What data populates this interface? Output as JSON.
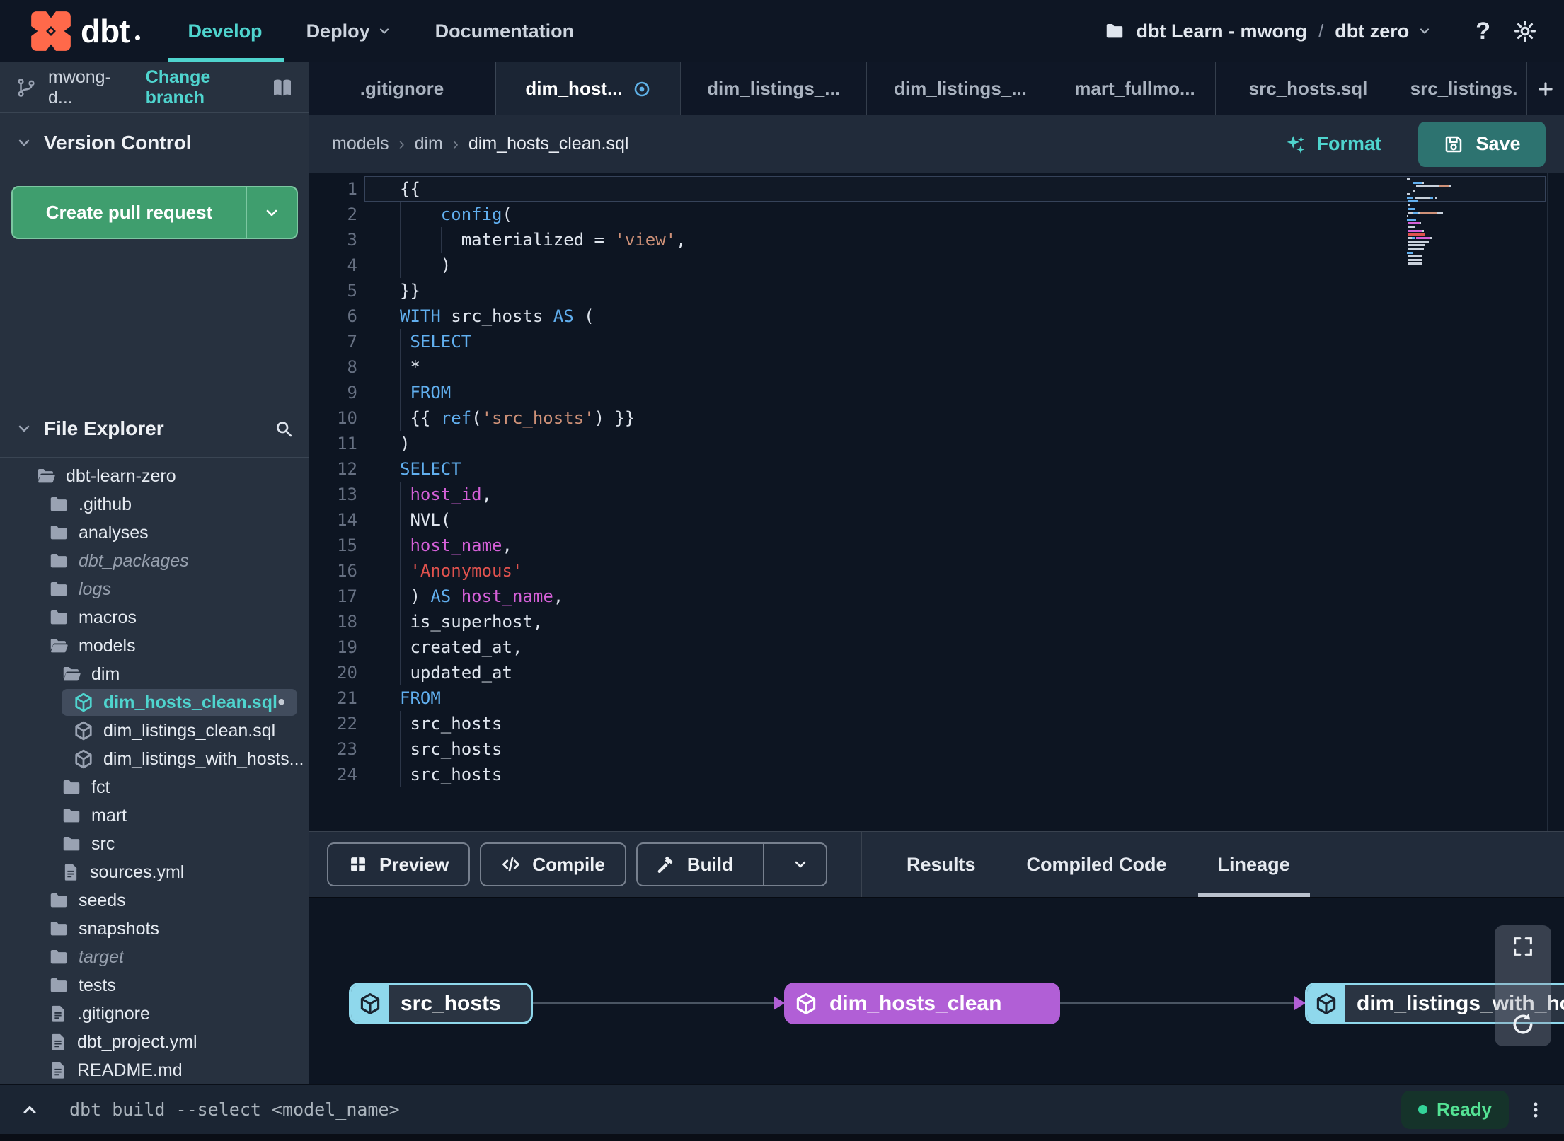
{
  "theme": {
    "navbar_bg": "#0e1624",
    "sidebar_bg": "#27313f",
    "divider": "#3a4553",
    "strip_bg": "#0f1726",
    "active_tab_bg": "#1b2534",
    "header_bg": "#212b3a",
    "editor_bg": "#0d1522",
    "panel_bg": "#212b3a",
    "lineage_bg": "#0d1522",
    "statusbar_bg": "#1b2533",
    "accent_teal": "#4fd4ce",
    "green": "#3f9e6e",
    "green_border": "#7cc7a1",
    "save_teal": "#2d7370",
    "kw": "#61afef",
    "str": "#ce9178",
    "str_red": "#e0524e",
    "magenta": "#d560d8",
    "fg": "#dfe5ee",
    "line_num": "#667082",
    "node_blue": "#8fd8ec",
    "node_purple": "#b15fd6",
    "edge": "#4a5563",
    "ready_green": "#54e294",
    "logo_orange": "#ff694a"
  },
  "navbar": {
    "logo_text": "dbt",
    "items": [
      {
        "label": "Develop",
        "active": true,
        "chevron": false
      },
      {
        "label": "Deploy",
        "active": false,
        "chevron": true
      },
      {
        "label": "Documentation",
        "active": false,
        "chevron": false
      }
    ],
    "account": "dbt Learn - mwong",
    "separator": "/",
    "project": "dbt zero",
    "help_label": "?"
  },
  "sidebar": {
    "branch_name": "mwong-d...",
    "change_branch_label": "Change branch",
    "version_control_label": "Version Control",
    "create_pr_label": "Create pull request",
    "file_explorer_label": "File Explorer",
    "tree": [
      {
        "name": "dbt-learn-zero",
        "icon": "folder-open",
        "level": 1
      },
      {
        "name": ".github",
        "icon": "folder",
        "level": 2
      },
      {
        "name": "analyses",
        "icon": "folder",
        "level": 2
      },
      {
        "name": "dbt_packages",
        "icon": "folder",
        "level": 2,
        "muted": true
      },
      {
        "name": "logs",
        "icon": "folder",
        "level": 2,
        "muted": true
      },
      {
        "name": "macros",
        "icon": "folder",
        "level": 2
      },
      {
        "name": "models",
        "icon": "folder-open",
        "level": 2
      },
      {
        "name": "dim",
        "icon": "folder-open",
        "level": 3
      },
      {
        "name": "dim_hosts_clean.sql",
        "icon": "model",
        "level": 4,
        "selected": true,
        "modified": true
      },
      {
        "name": "dim_listings_clean.sql",
        "icon": "model",
        "level": 4
      },
      {
        "name": "dim_listings_with_hosts...",
        "icon": "model",
        "level": 4
      },
      {
        "name": "fct",
        "icon": "folder",
        "level": 3
      },
      {
        "name": "mart",
        "icon": "folder",
        "level": 3
      },
      {
        "name": "src",
        "icon": "folder",
        "level": 3
      },
      {
        "name": "sources.yml",
        "icon": "file",
        "level": 3
      },
      {
        "name": "seeds",
        "icon": "folder",
        "level": 2
      },
      {
        "name": "snapshots",
        "icon": "folder",
        "level": 2
      },
      {
        "name": "target",
        "icon": "folder",
        "level": 2,
        "muted": true
      },
      {
        "name": "tests",
        "icon": "folder",
        "level": 2
      },
      {
        "name": ".gitignore",
        "icon": "file",
        "level": 2
      },
      {
        "name": "dbt_project.yml",
        "icon": "file",
        "level": 2
      },
      {
        "name": "README.md",
        "icon": "file",
        "level": 2
      }
    ]
  },
  "tabs": [
    {
      "label": ".gitignore"
    },
    {
      "label": "dim_host...",
      "active": true,
      "modified": true
    },
    {
      "label": "dim_listings_..."
    },
    {
      "label": "dim_listings_..."
    },
    {
      "label": "mart_fullmo..."
    },
    {
      "label": "src_hosts.sql"
    },
    {
      "label": "src_listings."
    }
  ],
  "editor_header": {
    "breadcrumb": [
      "models",
      "dim",
      "dim_hosts_clean.sql"
    ],
    "format_label": "Format",
    "save_label": "Save"
  },
  "editor": {
    "lines": [
      {
        "n": 1,
        "current": true,
        "tokens": [
          [
            "fg",
            "{{"
          ]
        ]
      },
      {
        "n": 2,
        "g": [
          0
        ],
        "tokens": [
          [
            "fg",
            "    "
          ],
          [
            "kw",
            "config"
          ],
          [
            "fg",
            "("
          ]
        ]
      },
      {
        "n": 3,
        "g": [
          0,
          58
        ],
        "tokens": [
          [
            "fg",
            "      materialized = "
          ],
          [
            "str",
            "'view'"
          ],
          [
            "fg",
            ","
          ]
        ]
      },
      {
        "n": 4,
        "g": [
          0
        ],
        "tokens": [
          [
            "fg",
            "    )"
          ]
        ]
      },
      {
        "n": 5,
        "tokens": [
          [
            "fg",
            "}}"
          ]
        ]
      },
      {
        "n": 6,
        "tokens": [
          [
            "kw",
            "WITH"
          ],
          [
            "fg",
            " src_hosts "
          ],
          [
            "kw",
            "AS"
          ],
          [
            "fg",
            " ("
          ]
        ]
      },
      {
        "n": 7,
        "g": [
          0
        ],
        "tokens": [
          [
            "fg",
            " "
          ],
          [
            "kw",
            "SELECT"
          ]
        ]
      },
      {
        "n": 8,
        "g": [
          0
        ],
        "tokens": [
          [
            "fg",
            " *"
          ]
        ]
      },
      {
        "n": 9,
        "g": [
          0
        ],
        "tokens": [
          [
            "fg",
            " "
          ],
          [
            "kw",
            "FROM"
          ]
        ]
      },
      {
        "n": 10,
        "g": [
          0
        ],
        "tokens": [
          [
            "fg",
            " {{ "
          ],
          [
            "kw",
            "ref"
          ],
          [
            "fg",
            "("
          ],
          [
            "str",
            "'src_hosts'"
          ],
          [
            "fg",
            ") }}"
          ]
        ]
      },
      {
        "n": 11,
        "tokens": [
          [
            "fg",
            ")"
          ]
        ]
      },
      {
        "n": 12,
        "tokens": [
          [
            "kw",
            "SELECT"
          ]
        ]
      },
      {
        "n": 13,
        "g": [
          0
        ],
        "tokens": [
          [
            "fg",
            " "
          ],
          [
            "mag",
            "host_id"
          ],
          [
            "fg",
            ","
          ]
        ]
      },
      {
        "n": 14,
        "g": [
          0
        ],
        "tokens": [
          [
            "fg",
            " NVL("
          ]
        ]
      },
      {
        "n": 15,
        "g": [
          0
        ],
        "tokens": [
          [
            "fg",
            " "
          ],
          [
            "mag",
            "host_name"
          ],
          [
            "fg",
            ","
          ]
        ]
      },
      {
        "n": 16,
        "g": [
          0
        ],
        "tokens": [
          [
            "fg",
            " "
          ],
          [
            "strr",
            "'Anonymous'"
          ]
        ]
      },
      {
        "n": 17,
        "g": [
          0
        ],
        "tokens": [
          [
            "fg",
            " ) "
          ],
          [
            "kw",
            "AS"
          ],
          [
            "fg",
            " "
          ],
          [
            "mag",
            "host_name"
          ],
          [
            "fg",
            ","
          ]
        ]
      },
      {
        "n": 18,
        "g": [
          0
        ],
        "tokens": [
          [
            "fg",
            " is_superhost,"
          ]
        ]
      },
      {
        "n": 19,
        "g": [
          0
        ],
        "tokens": [
          [
            "fg",
            " created_at,"
          ]
        ]
      },
      {
        "n": 20,
        "g": [
          0
        ],
        "tokens": [
          [
            "fg",
            " updated_at"
          ]
        ]
      },
      {
        "n": 21,
        "tokens": [
          [
            "kw",
            "FROM"
          ]
        ]
      },
      {
        "n": 22,
        "g": [
          0
        ],
        "tokens": [
          [
            "fg",
            " src_hosts"
          ]
        ]
      },
      {
        "n": 23,
        "g": [
          0
        ],
        "tokens": [
          [
            "fg",
            " src_hosts"
          ]
        ]
      },
      {
        "n": 24,
        "g": [
          0
        ],
        "tokens": [
          [
            "fg",
            " src_hosts"
          ]
        ]
      }
    ]
  },
  "bottom_panel": {
    "buttons": [
      {
        "label": "Preview",
        "icon": "grid"
      },
      {
        "label": "Compile",
        "icon": "code"
      },
      {
        "label": "Build",
        "icon": "hammer",
        "split": true
      }
    ],
    "tabs": [
      {
        "label": "Results"
      },
      {
        "label": "Compiled Code"
      },
      {
        "label": "Lineage",
        "active": true
      }
    ]
  },
  "lineage": {
    "nodes": [
      {
        "label": "src_hosts",
        "style": "source"
      },
      {
        "label": "dim_hosts_clean",
        "style": "highlight"
      },
      {
        "label": "dim_listings_with_hosts",
        "style": "source"
      }
    ]
  },
  "statusbar": {
    "command": "dbt build --select <model_name>",
    "ready_label": "Ready"
  }
}
